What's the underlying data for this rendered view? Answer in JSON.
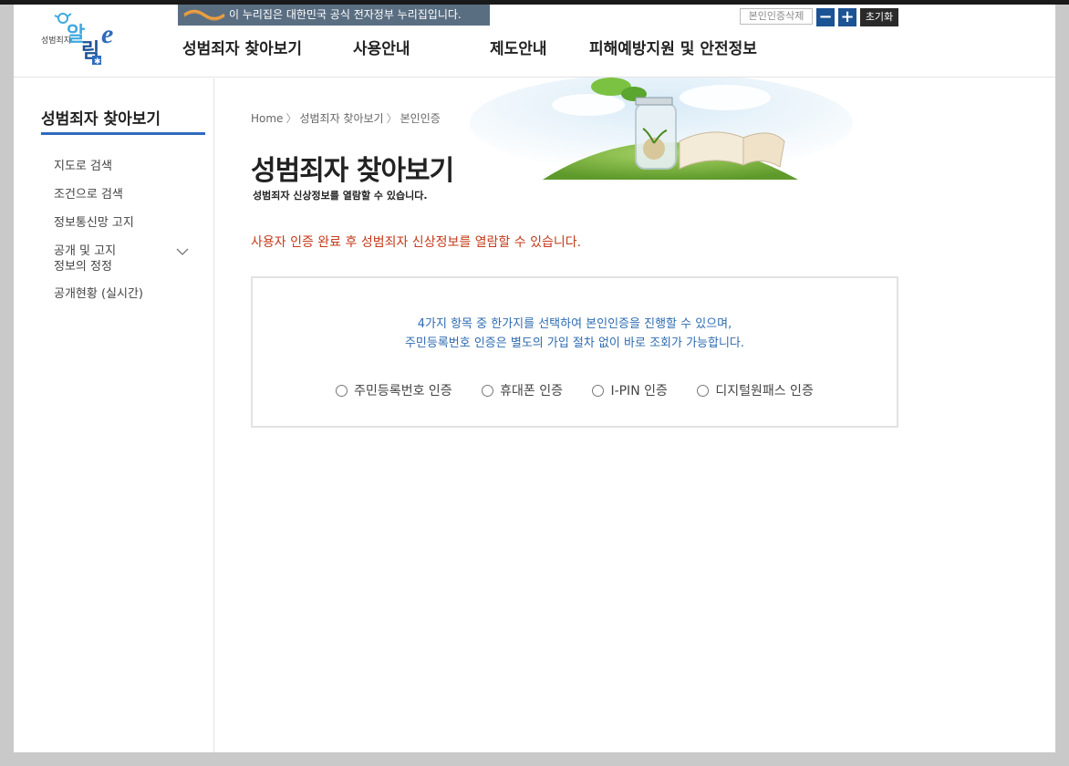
{
  "header": {
    "logo_text": "성범죄자 알림e",
    "gov_banner": "이 누리집은 대한민국 공식 전자정부 누리집입니다.",
    "tools": {
      "delete_auth": "본인인증삭제",
      "zoom_out": "−",
      "zoom_in": "+",
      "reset": "초기화"
    },
    "nav": [
      {
        "label": "성범죄자 찾아보기"
      },
      {
        "label": "사용안내"
      },
      {
        "label": "제도안내"
      },
      {
        "label": "피해예방지원 및 안전정보"
      }
    ]
  },
  "sidebar": {
    "title": "성범죄자 찾아보기",
    "items": [
      {
        "label": "지도로 검색"
      },
      {
        "label": "조건으로 검색"
      },
      {
        "label": "정보통신망 고지"
      },
      {
        "label_line1": "공개 및 고지",
        "label_line2": "정보의 정정"
      },
      {
        "label": "공개현황 (실시간)"
      }
    ]
  },
  "breadcrumb": [
    "Home",
    "성범죄자 찾아보기",
    "본인인증"
  ],
  "main": {
    "title": "성범죄자 찾아보기",
    "description": "성범죄자 신상정보를 열람할 수 있습니다.",
    "notice": "사용자 인증 완료 후 성범죄자 신상정보를 열람할 수 있습니다.",
    "guide_line1": "4가지 항목 중 한가지를 선택하여 본인인증을 진행할 수 있으며,",
    "guide_line2": "주민등록번호 인증은 별도의 가입 절차 없이 바로 조회가 가능합니다.",
    "auth_options": [
      {
        "label": "주민등록번호 인증"
      },
      {
        "label": "휴대폰 인증"
      },
      {
        "label": "I-PIN 인증"
      },
      {
        "label": "디지털원패스 인증"
      }
    ]
  },
  "colors": {
    "accent_blue": "#2e6bbd",
    "notice_red": "#c33a1a",
    "guide_blue": "#2e6bb0",
    "banner_bg": "#5a6e82"
  }
}
